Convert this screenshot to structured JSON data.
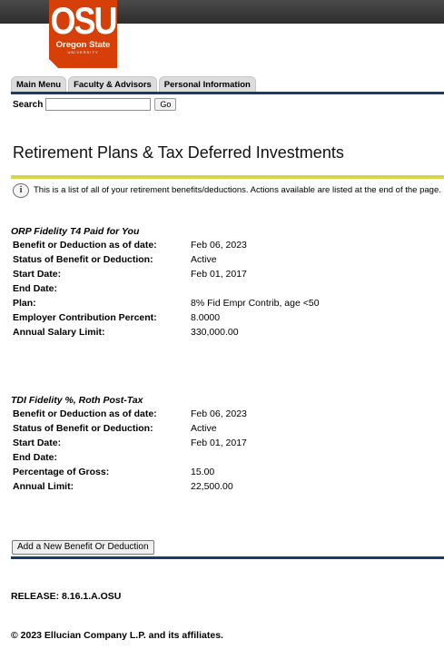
{
  "header": {
    "logo": {
      "mark": "OSU",
      "name": "Oregon State",
      "sub": "UNIVERSITY"
    }
  },
  "nav": {
    "tabs": [
      {
        "label": "Main Menu"
      },
      {
        "label": "Faculty & Advisors"
      },
      {
        "label": "Personal Information"
      }
    ]
  },
  "search": {
    "label": "Search",
    "value": "",
    "go_label": "Go"
  },
  "page": {
    "title": "Retirement Plans & Tax Deferred Investments",
    "info_icon": "info-icon",
    "info_text": "This is a list of all of your retirement benefits/deductions. Actions available are listed at the end of the page."
  },
  "plans": [
    {
      "title": "ORP Fidelity T4 Paid for You",
      "rows": [
        {
          "label": "Benefit or Deduction as of date:",
          "value": "Feb 06, 2023"
        },
        {
          "label": "Status of Benefit or Deduction:",
          "value": "Active"
        },
        {
          "label": "Start Date:",
          "value": "Feb 01, 2017"
        },
        {
          "label": "End Date:",
          "value": ""
        },
        {
          "label": "Plan:",
          "value": "8% Fid Empr Contrib, age <50"
        },
        {
          "label": "Employer Contribution Percent:",
          "value": "8.0000"
        },
        {
          "label": "Annual Salary Limit:",
          "value": "330,000.00"
        }
      ]
    },
    {
      "title": "TDI Fidelity %, Roth Post-Tax",
      "rows": [
        {
          "label": "Benefit or Deduction as of date:",
          "value": "Feb 06, 2023"
        },
        {
          "label": "Status of Benefit or Deduction:",
          "value": "Active"
        },
        {
          "label": "Start Date:",
          "value": "Feb 01, 2017"
        },
        {
          "label": "End Date:",
          "value": ""
        },
        {
          "label": "Percentage of Gross:",
          "value": "15.00"
        },
        {
          "label": "Annual Limit:",
          "value": "22,500.00"
        }
      ]
    }
  ],
  "actions": {
    "add_label": "Add a New Benefit Or Deduction"
  },
  "footer": {
    "release": "RELEASE: 8.16.1.A.OSU",
    "copyright": "© 2023 Ellucian Company L.P. and its affiliates."
  }
}
